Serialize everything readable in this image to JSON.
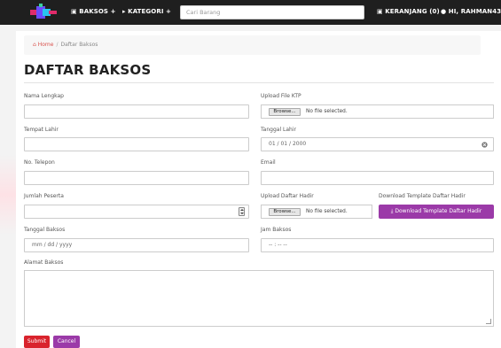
{
  "navbar": {
    "menu_baksos": "BAKSOS +",
    "menu_kategori": "KATEGORI +",
    "search_placeholder": "Cari Barang",
    "cart": "KERANJANG (0)",
    "user": "HI, RAHMAN43"
  },
  "breadcrumb": {
    "home": "Home",
    "separator": "/",
    "current": "Daftar Baksos"
  },
  "page_title": "DAFTAR BAKSOS",
  "form": {
    "nama_label": "Nama Lengkap",
    "ktp_label": "Upload File KTP",
    "tempat_lahir_label": "Tempat Lahir",
    "tanggal_lahir_label": "Tanggal Lahir",
    "tanggal_lahir_value": "01 / 01 / 2000",
    "telepon_label": "No. Telepon",
    "email_label": "Email",
    "jumlah_label": "Jumlah Peserta",
    "daftar_hadir_label": "Upload Daftar Hadir",
    "template_label": "Download Template Daftar Hadir",
    "template_button": "Download Template Daftar Hadir",
    "tanggal_baksos_label": "Tanggal Baksos",
    "tanggal_baksos_placeholder": "mm / dd / yyyy",
    "jam_baksos_label": "Jam Baksos",
    "jam_baksos_placeholder": "-- : --  --",
    "alamat_label": "Alamat Baksos",
    "browse": "Browse...",
    "no_file": "No file selected.",
    "submit": "Submit",
    "cancel": "Cancel"
  },
  "colors": {
    "navbar": "#1f1f1f",
    "submit": "#d9232d",
    "accent_purple": "#9b3aa8",
    "home_link": "#d9534f"
  }
}
